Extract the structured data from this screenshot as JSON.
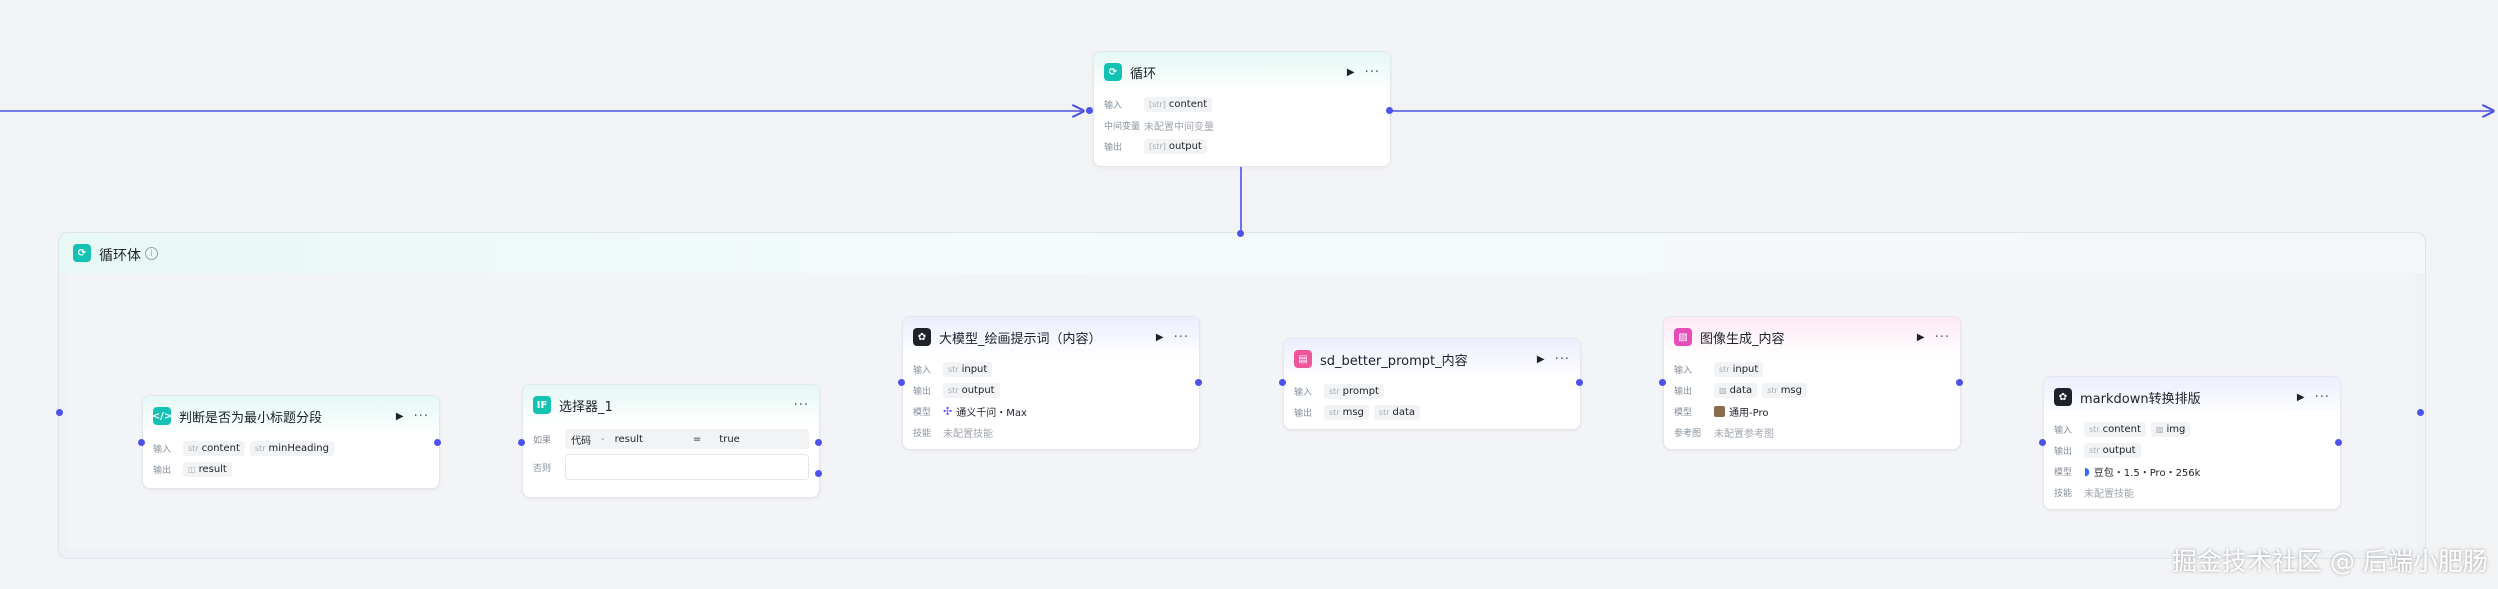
{
  "loop_body": {
    "title": "循环体"
  },
  "nodes": {
    "loop": {
      "title": "循环",
      "rows": {
        "input_label": "输入",
        "input_value": "content",
        "mid_label": "中间变量",
        "mid_value": "未配置中间变量",
        "output_label": "输出",
        "output_value": "output"
      }
    },
    "judge": {
      "title": "判断是否为最小标题分段",
      "rows": {
        "input_label": "输入",
        "input_values": [
          "content",
          "minHeading"
        ],
        "output_label": "输出",
        "output_value": "result"
      }
    },
    "selector": {
      "title": "选择器_1",
      "if_label": "如果",
      "cond_var": "代码",
      "cond_field": "result",
      "cond_op": "=",
      "cond_value": "true",
      "else_label": "否则"
    },
    "llm_prompt": {
      "title": "大模型_绘画提示词（内容）",
      "rows": {
        "input_label": "输入",
        "input_value": "input",
        "output_label": "输出",
        "output_value": "output",
        "model_label": "模型",
        "model_value": "通义千问・Max",
        "skill_label": "技能",
        "skill_value": "未配置技能"
      }
    },
    "sd_better": {
      "title": "sd_better_prompt_内容",
      "rows": {
        "input_label": "输入",
        "input_value": "prompt",
        "output_label": "输出",
        "output_values": [
          "msg",
          "data"
        ]
      }
    },
    "image_gen": {
      "title": "图像生成_内容",
      "rows": {
        "input_label": "输入",
        "input_value": "input",
        "output_label": "输出",
        "output_values": [
          "data",
          "msg"
        ],
        "model_label": "模型",
        "model_value": "通用-Pro",
        "ref_label": "参考图",
        "ref_value": "未配置参考图"
      }
    },
    "markdown": {
      "title": "markdown转换排版",
      "rows": {
        "input_label": "输入",
        "input_values": [
          "content",
          "img"
        ],
        "output_label": "输出",
        "output_value": "output",
        "model_label": "模型",
        "model_value": "豆包・1.5・Pro・256k",
        "skill_label": "技能",
        "skill_value": "未配置技能"
      }
    }
  },
  "icons": [
    "loop-icon",
    "code-icon",
    "if-icon",
    "llm-icon",
    "plugin-icon",
    "image-icon",
    "play-icon",
    "more-icon",
    "info-icon"
  ],
  "colors": {
    "edge": "#4d53e8",
    "teal": "#13c2b3",
    "pink": "#f0569b"
  },
  "watermark": "掘金技术社区 @ 后端小肥肠"
}
